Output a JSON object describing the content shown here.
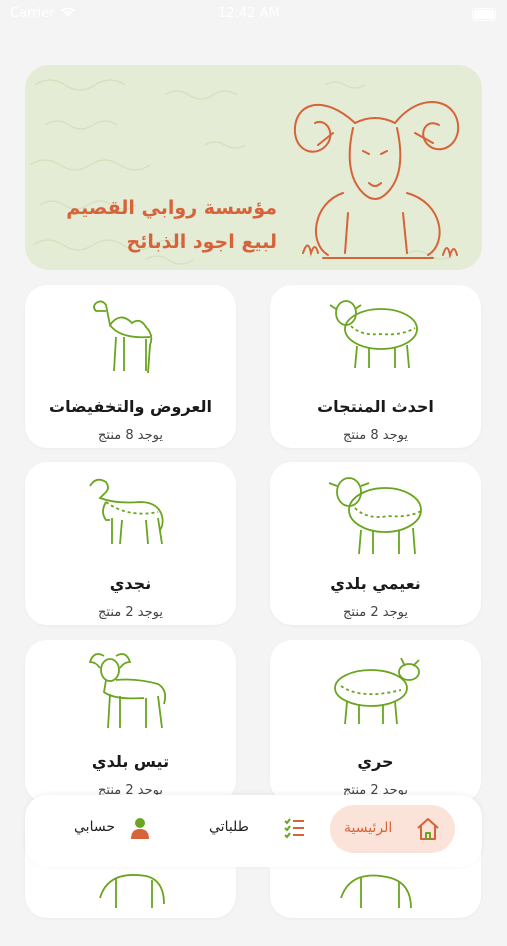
{
  "status_bar": {
    "carrier": "Carrier",
    "time": "12:42 AM"
  },
  "banner": {
    "line1": "مؤسسة روابي القصيم",
    "line2": "لبيع اجود الذبائح",
    "accent_color": "#d6633a",
    "background_color": "#e4ecd6"
  },
  "categories": [
    {
      "title": "احدث المنتجات",
      "count": "يوجد 8 منتج",
      "icon": "sheep-icon"
    },
    {
      "title": "العروض والتخفيضات",
      "count": "يوجد 8 منتج",
      "icon": "camel-icon"
    },
    {
      "title": "نعيمي بلدي",
      "count": "يوجد 2 منتج",
      "icon": "sheep-icon"
    },
    {
      "title": "نجدي",
      "count": "يوجد 2 منتج",
      "icon": "lamb-icon"
    },
    {
      "title": "حري",
      "count": "يوجد 2 منتج",
      "icon": "sheep-icon"
    },
    {
      "title": "تيس بلدي",
      "count": "يوجد 2 منتج",
      "icon": "goat-icon"
    }
  ],
  "nav": {
    "home": "الرئيسية",
    "orders": "طلباتي",
    "account": "حسابي",
    "active_color": "#d6633a",
    "icon_green": "#6aa51f"
  }
}
